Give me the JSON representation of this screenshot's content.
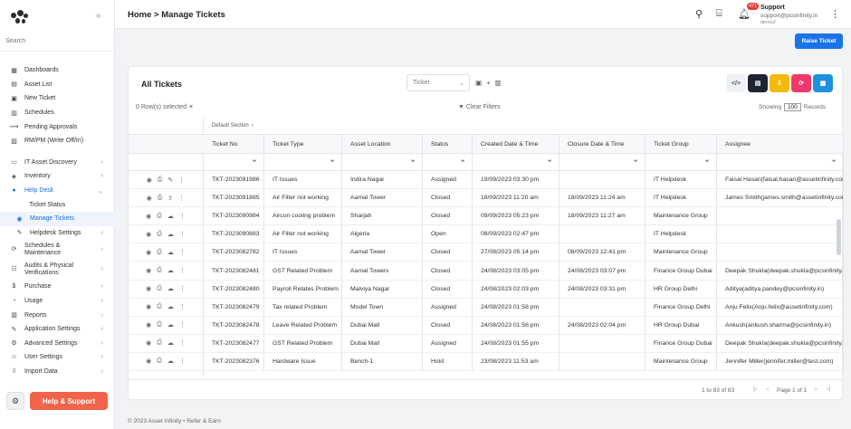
{
  "sidebar": {
    "search_placeholder": "Search",
    "items": [
      {
        "label": "Dashboards",
        "icon": "grid-icon"
      },
      {
        "label": "Asset List",
        "icon": "list-icon"
      },
      {
        "label": "New Ticket",
        "icon": "ticket-icon"
      },
      {
        "label": "Schedules",
        "icon": "calendar-icon"
      },
      {
        "label": "Pending Approvals",
        "icon": "approval-icon"
      },
      {
        "label": "RM/PM (Write Off/In)",
        "icon": "tools-icon"
      }
    ],
    "items2": [
      {
        "label": "IT Asset Discovery",
        "icon": "monitor-icon"
      },
      {
        "label": "Inventory",
        "icon": "box-icon"
      },
      {
        "label": "Help Desk",
        "icon": "help-icon"
      },
      {
        "label": "Ticket Status",
        "icon": ""
      },
      {
        "label": "Manage Tickets",
        "icon": "tickets-icon"
      },
      {
        "label": "Helpdesk Settings",
        "icon": "wrench-icon"
      },
      {
        "label": "Schedules &",
        "label2": "Maintenance",
        "icon": "schedule-icon"
      },
      {
        "label": "Audits & Physical",
        "label2": "Verifications",
        "icon": "audit-icon"
      },
      {
        "label": "Purchase",
        "icon": "dollar-icon"
      },
      {
        "label": "Usage",
        "icon": "usage-icon"
      },
      {
        "label": "Reports",
        "icon": "report-icon"
      },
      {
        "label": "Application Settings",
        "icon": "app-settings-icon"
      },
      {
        "label": "Advanced Settings",
        "icon": "adv-settings-icon"
      },
      {
        "label": "User Settings",
        "icon": "user-icon"
      },
      {
        "label": "Import Data",
        "icon": "import-icon"
      }
    ],
    "help_label": "Help & Support"
  },
  "header": {
    "breadcrumb": "Home > Manage Tickets",
    "notif_count": "471",
    "user_name": "Support",
    "user_email": "support@pcsinfinity.in",
    "user_db": "demo2"
  },
  "raise_label": "Raise Ticket",
  "card": {
    "title": "All Tickets",
    "select_value": "Ticket",
    "rows_selected": "0 Row(s) selected",
    "clear_filters": "Clear Filters",
    "showing_label": "Showing",
    "showing_value": "100",
    "records_label": "Records",
    "group_label": "Default Section",
    "toolbar_colors": {
      "code": "#eef1f6",
      "doc": "#1f2433",
      "download": "#f5b90a",
      "refresh": "#f0386b",
      "calendar": "#1e90e0"
    }
  },
  "table": {
    "columns": [
      "Ticket No",
      "Ticket Type",
      "Asset Location",
      "Status",
      "Created Date & Time",
      "Closure Date & Time",
      "Ticket Group",
      "Assignee"
    ],
    "rows": [
      [
        "TKT-2023091986",
        "IT Issues",
        "Indira Nagar",
        "Assigned",
        "19/09/2023 03:30 pm",
        "",
        "IT Helpdesk",
        "Faisal Hasan(faisal.hasan@assetinfinity.com)"
      ],
      [
        "TKT-2023091885",
        "Air Filter not working",
        "Aamal Tower",
        "Closed",
        "18/09/2023 11:20 am",
        "18/09/2023 11:24 am",
        "IT Helpdesk",
        "James Smith(james.smith@assetinfinity.com)"
      ],
      [
        "TKT-2023090984",
        "Aircon cooling problem",
        "Sharjah",
        "Closed",
        "09/09/2023 05:23 pm",
        "18/09/2023 11:27 am",
        "Maintenance Group",
        ""
      ],
      [
        "TKT-2023090883",
        "Air Filter not working",
        "Algeria",
        "Open",
        "08/09/2023 02:47 pm",
        "",
        "IT Helpdesk",
        ""
      ],
      [
        "TKT-2023082782",
        "IT Issues",
        "Aamal Tower",
        "Closed",
        "27/08/2023 05:14 pm",
        "08/09/2023 12:41 pm",
        "Maintenance Group",
        ""
      ],
      [
        "TKT-2023082481",
        "GST Related Problem",
        "Aamal Towers",
        "Closed",
        "24/08/2023 03:05 pm",
        "24/08/2023 03:07 pm",
        "Finance Group Dubai",
        "Deepak Shukla(deepak.shukla@pcsinfinity.in)"
      ],
      [
        "TKT-2023082480",
        "Payroll Relates Problem",
        "Malviya Nagar",
        "Closed",
        "24/08/2023 02:03 pm",
        "24/08/2023 03:31 pm",
        "HR Group Delhi",
        "Aditya(aditya.pandey@pcsinfinity.in)"
      ],
      [
        "TKT-2023082479",
        "Tax related Problem",
        "Model Town",
        "Assigned",
        "24/08/2023 01:58 pm",
        "",
        "Finance Group Delhi",
        "Anju Felix(Anju.felix@assetinfinity.com)"
      ],
      [
        "TKT-2023082478",
        "Leave Related Problem",
        "Dubai Mall",
        "Closed",
        "24/08/2023 01:56 pm",
        "24/08/2023 02:04 pm",
        "HR Group Dubai",
        "Ankush(ankush.sharma@pcsinfinity.in)"
      ],
      [
        "TKT-2023082477",
        "GST Related Problem",
        "Dubai Mall",
        "Assigned",
        "24/08/2023 01:55 pm",
        "",
        "Finance Group Dubai",
        "Deepak Shukla(deepak.shukla@pcsinfinity.in)"
      ],
      [
        "TKT-2023082376",
        "Hardware Issue",
        "Bench-1",
        "Hold",
        "23/08/2023 11:53 am",
        "",
        "Maintenance Group",
        "Jennifer Miller(jennifer.miller@test.com)"
      ]
    ]
  },
  "pager": {
    "info": "1 to 83 of 83",
    "page": "Page 1 of 1"
  },
  "footer": "© 2023  Asset Infinity • Refer & Earn"
}
